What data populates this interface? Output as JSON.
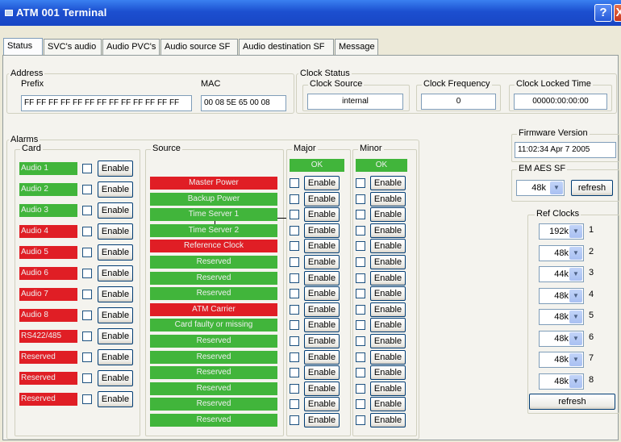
{
  "window": {
    "title": "ATM 001 Terminal",
    "help_label": "?",
    "close_label": "X"
  },
  "tabs": [
    "Status",
    "SVC's audio",
    "Audio PVC's",
    "Audio source SF",
    "Audio destination SF",
    "Message"
  ],
  "address": {
    "legend": "Address",
    "prefix_label": "Prefix",
    "prefix_value": "FF FF FF FF FF FF FF FF FF FF FF FF FF",
    "mac_label": "MAC",
    "mac_value": "00 08 5E 65 00 08"
  },
  "clock_status": {
    "legend": "Clock Status",
    "source_label": "Clock Source",
    "source_value": "internal",
    "frequency_label": "Clock Frequency",
    "frequency_value": "0",
    "locked_label": "Clock Locked Time",
    "locked_value": "00000:00:00:00"
  },
  "alarms": {
    "legend": "Alarms",
    "card_label": "Card",
    "source_label": "Source",
    "major_label": "Major",
    "minor_label": "Minor",
    "enable_label": "Enable",
    "major_status": "OK",
    "minor_status": "OK",
    "colors": {
      "ok": "#41b53b",
      "fault": "#e01e25"
    },
    "cards": [
      {
        "label": "Audio 1",
        "status": "green"
      },
      {
        "label": "Audio 2",
        "status": "green"
      },
      {
        "label": "Audio 3",
        "status": "green"
      },
      {
        "label": "Audio 4",
        "status": "red"
      },
      {
        "label": "Audio 5",
        "status": "red"
      },
      {
        "label": "Audio 6",
        "status": "red"
      },
      {
        "label": "Audio 7",
        "status": "red"
      },
      {
        "label": "Audio 8",
        "status": "red"
      },
      {
        "label": "RS422/485",
        "status": "red"
      },
      {
        "label": "Reserved",
        "status": "red"
      },
      {
        "label": "Reserved",
        "status": "red"
      },
      {
        "label": "Reserved",
        "status": "red"
      }
    ],
    "sources": [
      {
        "label": "Master Power",
        "status": "red"
      },
      {
        "label": "Backup Power",
        "status": "green"
      },
      {
        "label": "Time Server 1",
        "status": "green"
      },
      {
        "label": "Time Server 2",
        "status": "green"
      },
      {
        "label": "Reference Clock",
        "status": "red"
      },
      {
        "label": "Reserved",
        "status": "green"
      },
      {
        "label": "Reserved",
        "status": "green"
      },
      {
        "label": "Reserved",
        "status": "green"
      },
      {
        "label": "ATM Carrier",
        "status": "red"
      },
      {
        "label": "Card faulty or missing",
        "status": "green"
      },
      {
        "label": "Reserved",
        "status": "green"
      },
      {
        "label": "Reserved",
        "status": "green"
      },
      {
        "label": "Reserved",
        "status": "green"
      },
      {
        "label": "Reserved",
        "status": "green"
      },
      {
        "label": "Reserved",
        "status": "green"
      },
      {
        "label": "Reserved",
        "status": "green"
      }
    ]
  },
  "firmware": {
    "label": "Firmware Version",
    "value": "11:02:34 Apr  7 2005"
  },
  "em_aes": {
    "label": "EM AES SF",
    "value": "48k",
    "refresh_label": "refresh"
  },
  "ref_clocks": {
    "label": "Ref Clocks",
    "refresh_label": "refresh",
    "items": [
      {
        "value": "192k",
        "num": "1"
      },
      {
        "value": "48k",
        "num": "2"
      },
      {
        "value": "44k",
        "num": "3"
      },
      {
        "value": "48k",
        "num": "4"
      },
      {
        "value": "48k",
        "num": "5"
      },
      {
        "value": "48k",
        "num": "6"
      },
      {
        "value": "48k",
        "num": "7"
      },
      {
        "value": "48k",
        "num": "8"
      }
    ]
  }
}
